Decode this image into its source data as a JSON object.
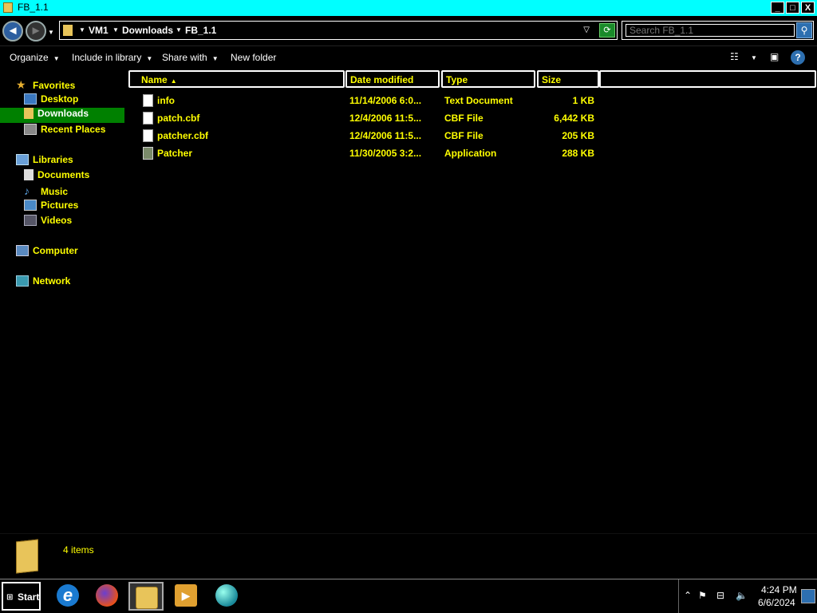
{
  "window": {
    "title": "FB_1.1",
    "buttons": {
      "minimize": "_",
      "maximize": "□",
      "close": "X"
    }
  },
  "address": {
    "crumbs": [
      "VM1",
      "Downloads",
      "FB_1.1"
    ]
  },
  "search": {
    "placeholder": "Search FB_1.1"
  },
  "toolbar": {
    "organize": "Organize",
    "include_in_library": "Include in library",
    "share_with": "Share with",
    "new_folder": "New folder",
    "help": "?"
  },
  "nav": {
    "favorites": "Favorites",
    "desktop": "Desktop",
    "downloads": "Downloads",
    "recent_places": "Recent Places",
    "libraries": "Libraries",
    "documents": "Documents",
    "music": "Music",
    "pictures": "Pictures",
    "videos": "Videos",
    "computer": "Computer",
    "network": "Network"
  },
  "columns": {
    "name": "Name",
    "date_modified": "Date modified",
    "type": "Type",
    "size": "Size"
  },
  "files": [
    {
      "name": "info",
      "date": "11/14/2006 6:0...",
      "type": "Text Document",
      "size": "1 KB",
      "icon": "text-file-icon"
    },
    {
      "name": "patch.cbf",
      "date": "12/4/2006 11:5...",
      "type": "CBF File",
      "size": "6,442 KB",
      "icon": "file-icon"
    },
    {
      "name": "patcher.cbf",
      "date": "12/4/2006 11:5...",
      "type": "CBF File",
      "size": "205 KB",
      "icon": "file-icon"
    },
    {
      "name": "Patcher",
      "date": "11/30/2005 3:2...",
      "type": "Application",
      "size": "288 KB",
      "icon": "application-icon"
    }
  ],
  "details": {
    "count": "4 items"
  },
  "taskbar": {
    "start": "Start",
    "apps": [
      "internet-explorer-icon",
      "firefox-icon",
      "windows-explorer-icon",
      "media-player-icon",
      "browser-globe-icon"
    ],
    "clock_time": "4:24 PM",
    "clock_date": "6/6/2024"
  },
  "colors": {
    "titlebar": "#00ffff",
    "text_highlight": "#ffff00",
    "selection": "#008000",
    "background": "#000000"
  }
}
